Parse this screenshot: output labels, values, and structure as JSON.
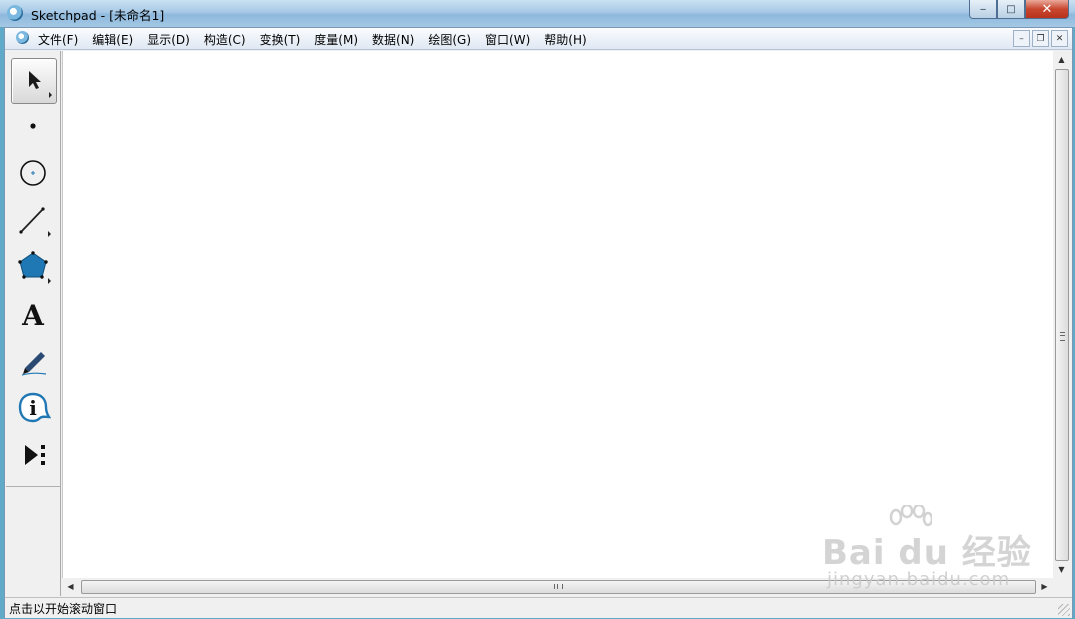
{
  "window": {
    "title": "Sketchpad  - [未命名1]",
    "controls": {
      "minimize": "‒",
      "maximize": "□",
      "close": "✕"
    }
  },
  "menubar": {
    "items": [
      {
        "label": "文件(F)"
      },
      {
        "label": "编辑(E)"
      },
      {
        "label": "显示(D)"
      },
      {
        "label": "构造(C)"
      },
      {
        "label": "变换(T)"
      },
      {
        "label": "度量(M)"
      },
      {
        "label": "数据(N)"
      },
      {
        "label": "绘图(G)"
      },
      {
        "label": "窗口(W)"
      },
      {
        "label": "帮助(H)"
      }
    ],
    "mdi_controls": {
      "minimize": "–",
      "restore": "❐",
      "close": "✕"
    }
  },
  "toolbox": {
    "tools": [
      {
        "name": "arrow-tool",
        "icon": "arrow-select-icon",
        "selected": true
      },
      {
        "name": "point-tool",
        "icon": "point-icon"
      },
      {
        "name": "compass-tool",
        "icon": "compass-circle-icon"
      },
      {
        "name": "straightedge-tool",
        "icon": "segment-icon"
      },
      {
        "name": "polygon-tool",
        "icon": "pentagon-icon"
      },
      {
        "name": "text-tool",
        "icon": "text-a-icon",
        "glyph": "A"
      },
      {
        "name": "marker-tool",
        "icon": "marker-pen-icon"
      },
      {
        "name": "information-tool",
        "icon": "info-icon",
        "glyph": "i"
      },
      {
        "name": "custom-tool",
        "icon": "play-custom-icon"
      }
    ]
  },
  "statusbar": {
    "text": "点击以开始滚动窗口"
  },
  "watermark": {
    "logo": "Bai du 经验",
    "url": "jingyan.baidu.com"
  },
  "colors": {
    "tool_blue": "#1f78b4",
    "canvas": "#ffffff",
    "chrome": "#f0f0f0"
  }
}
